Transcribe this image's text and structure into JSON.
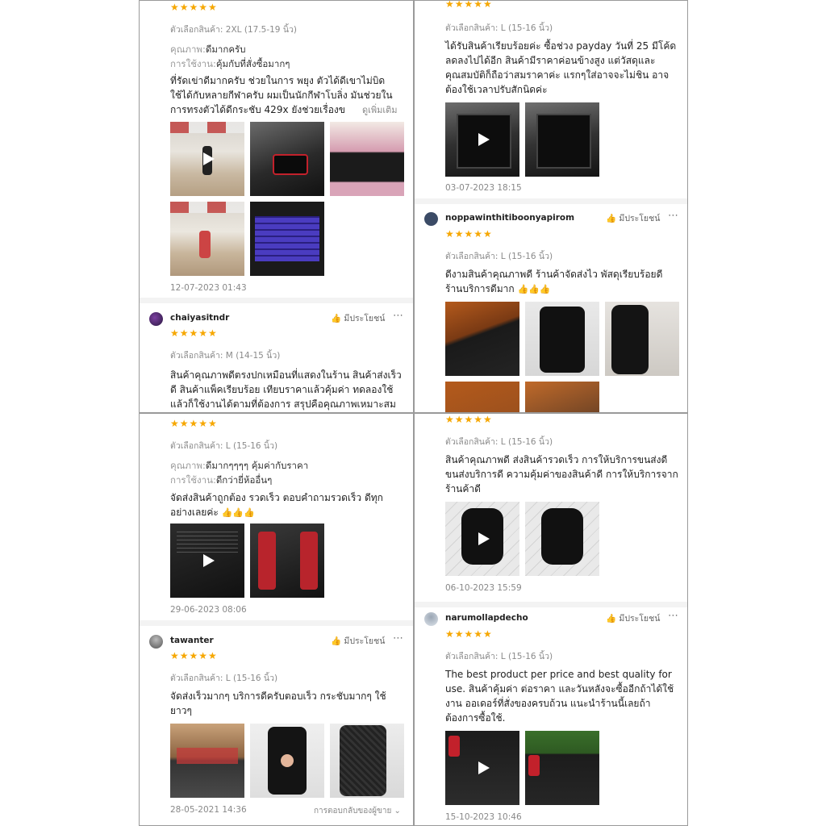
{
  "common": {
    "variant_label": "ตัวเลือกสินค้า:",
    "quality_label": "คุณภาพ:",
    "usage_label": "การใช้งาน:",
    "helpful_label": "มีประโยชน์",
    "see_more": "ดูเพิ่มเติม",
    "more_icon": "⋯",
    "stars": "★★★★★",
    "thumbs": "👍👍👍"
  },
  "panel1": {
    "r1": {
      "variant": "2XL (17.5-19 นิ้ว)",
      "quality": "ดีมากครับ",
      "usage": "คุ้มกับที่สั่งซื้อมากๆ",
      "body": "ที่รัดเข่าดีมากครับ ช่วยในการ พยุง ตัวได้ดีเขาไม่บิด ใช้ได้กับหลายกีฬาครับ ผมเป็นนักกีฬาโบลิ่ง มันช่วยในการทรงตัวได้ดีกระชับ 429x ยังช่วยเรื่องข",
      "date": "12-07-2023 01:43"
    },
    "r2": {
      "user": "chaiyasitndr",
      "variant": "M (14-15 นิ้ว)",
      "body": "สินค้าคุณภาพดีตรงปกเหมือนที่แสดงในร้าน สินค้าส่งเร็วดี สินค้าแพ็คเรียบร้อย เทียบราคาแล้วคุ้มค่า ทดลองใช้แล้วก็ใช้งานได้ตามที่ต้องการ สรุปคือคุณภาพเหมาะสม"
    }
  },
  "panel2": {
    "r1": {
      "variant": "L (15-16 นิ้ว)",
      "body": "ได้รับสินค้าเรียบร้อยค่ะ ซื้อช่วง payday วันที่ 25 มีโค้ดลดลงไปได้อีก สินค้ามีราคาค่อนข้างสูง แต่วัสดุและคุณสมบัติก็ถือว่าสมราคาค่ะ แรกๆใส่อาจจะไม่ชิน อาจต้องใช้เวลาปรับสักนิดค่ะ",
      "date": "03-07-2023 18:15"
    },
    "r2": {
      "user": "noppawinthitiboonyapirom",
      "variant": "L (15-16 นิ้ว)",
      "body": "ดีงามสินค้าคุณภาพดี ร้านค้าจัดส่งไว พัสดุเรียบร้อยดี ร้านบริการดีมาก"
    }
  },
  "panel3": {
    "r1": {
      "variant": "L (15-16 นิ้ว)",
      "quality": "ดีมากๆๆๆๆ คุ้มค่ากับราคา",
      "usage": "ดีกว่ายี่ห้ออื่นๆ",
      "body": "จัดส่งสินค้าถูกต้อง รวดเร็ว ตอบคำถามรวดเร็ว ดีทุกอย่างเลยค่ะ",
      "date": "29-06-2023 08:06"
    },
    "r2": {
      "user": "tawanter",
      "variant": "L (15-16 นิ้ว)",
      "body": "จัดส่งเร็วมากๆ บริการดีครับตอบเร็ว กระชับมากๆ ใช้ยาวๆ",
      "date": "28-05-2021 14:36",
      "reply": "การตอบกลับของผู้ขาย ⌄"
    }
  },
  "panel4": {
    "r1": {
      "variant": "L (15-16 นิ้ว)",
      "body": "สินค้าคุณภาพดี ส่งสินค้ารวดเร็ว การให้บริการขนส่งดีขนส่งบริการดี ความคุ้มค่าของสินค้าดี การให้บริการจากร้านค้าดี",
      "date": "06-10-2023 15:59"
    },
    "r2": {
      "user": "narumollapdecho",
      "variant": "L (15-16 นิ้ว)",
      "body": "The best product per price and best quality for use. สินค้าคุ้มค่า ต่อราคา และวันหลังจะซื้ออีกถ้าได้ใช้งาน ออเดอร์ที่สั่งของครบถ้วน แนะนำร้านนี้เลยถ้าต้องการซื้อใช้.",
      "date": "15-10-2023 10:46"
    }
  }
}
